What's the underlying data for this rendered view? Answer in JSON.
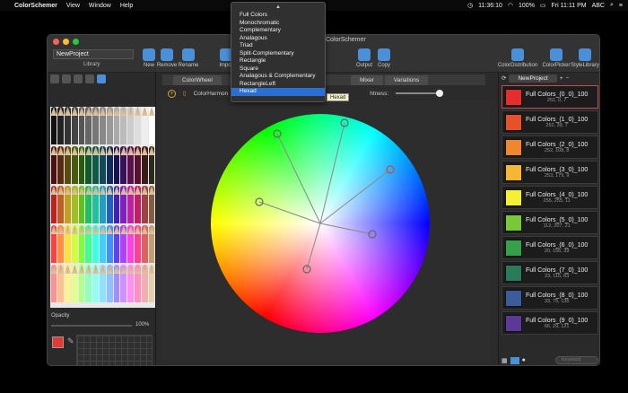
{
  "menubar": {
    "app": "ColorSchemer",
    "items": [
      "View",
      "Window",
      "Help"
    ],
    "time": "11:36:10",
    "battery": "100%",
    "datetime": "Fri 11:11 PM",
    "input": "ABC"
  },
  "window": {
    "title": "ColorSchemer",
    "project_name": "NewProject",
    "library_label": "Library",
    "toolbar": {
      "new": "New",
      "remove": "Remove",
      "rename": "Rename",
      "import": "Impor",
      "output": "Output",
      "copy": "Copy",
      "color_distribution": "ColorDistribution",
      "color_picker": "ColorPicker",
      "style_library": "StyleLibrary"
    }
  },
  "left": {
    "opacity_label": "Opacity",
    "opacity_value": "100%"
  },
  "center": {
    "tabs": [
      "ColorWheel",
      "Mixer",
      "Variations"
    ],
    "harmony_label": "ColorHarmon",
    "brightness_label": "htness:",
    "swatch_colors": [
      "#7a5cf5",
      "#f06ad0",
      "#f58a5e",
      "#d6f56a",
      "#6af56a",
      "#6ad4f5"
    ]
  },
  "dropdown": {
    "items": [
      "Full Colors",
      "Monochromatic",
      "Complementary",
      "Analagous",
      "Triad",
      "Split-Complementary",
      "Rectangle",
      "Square",
      "Analagous & Complementary",
      "RectangleLeft",
      "Hexad"
    ],
    "selected": "Hexad",
    "tooltip": "Hexad"
  },
  "right": {
    "project": "NewProject",
    "search_placeholder": "Keyword",
    "items": [
      {
        "name": "Full Colors_(0_0)_100",
        "rgb": "251, 0, 7",
        "color": "#e52d2d"
      },
      {
        "name": "Full Colors_(1_0)_100",
        "rgb": "252, 39, 7",
        "color": "#e8502a"
      },
      {
        "name": "Full Colors_(2_0)_100",
        "rgb": "252, 108, 8",
        "color": "#f0862d"
      },
      {
        "name": "Full Colors_(3_0)_100",
        "rgb": "253, 179, 9",
        "color": "#f5b733"
      },
      {
        "name": "Full Colors_(4_0)_100",
        "rgb": "255, 255, 11",
        "color": "#f5f032"
      },
      {
        "name": "Full Colors_(5_0)_100",
        "rgb": "112, 207, 21",
        "color": "#78c83a"
      },
      {
        "name": "Full Colors_(6_0)_100",
        "rgb": "20, 156, 39",
        "color": "#35a04a"
      },
      {
        "name": "Full Colors_(7_0)_100",
        "rgb": "23, 115, 83",
        "color": "#2c7a5c"
      },
      {
        "name": "Full Colors_(8_0)_100",
        "rgb": "33, 75, 135",
        "color": "#3a5c9a"
      },
      {
        "name": "Full Colors_(9_0)_100",
        "rgb": "66, 29, 121",
        "color": "#5a3a96"
      }
    ]
  }
}
